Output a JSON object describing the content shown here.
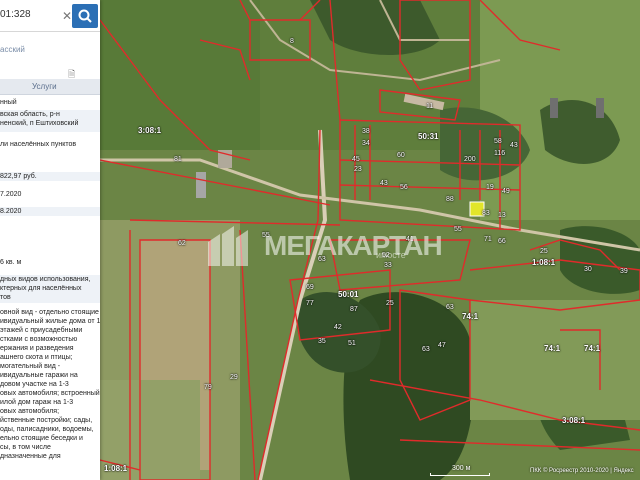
{
  "search": {
    "value": "01:328"
  },
  "subtitle": "асский",
  "tabs": {
    "services": "Услуги"
  },
  "info_rows": [
    "нный",
    "вская область, р-н",
    "ненский, п Ештиховский",
    "ли населённых пунктов",
    "822,97 руб.",
    "7.2020",
    "8.2020",
    "6 кв. м",
    "дных видов использования,",
    "ктерных для населённых",
    "тов",
    "овной вид - отдельно стоящие",
    "ивидуальный жилые дома от 1",
    "этажей с приусадебными",
    "стками с возможностью",
    "ержания и разведения",
    "ашнего скота и птицы;",
    "могательный вид -",
    "ивидуальные гаражи на",
    "довом участке на 1-3",
    "овых автомобиля; встроенный",
    "илой дом гараж на 1-3",
    "овых автомобиля;",
    "йственные постройки; сады,",
    "оды, палисадники, водоемы,",
    "ельно стоящие беседки и",
    "сы, в том числе",
    "дназначенные для"
  ],
  "map": {
    "watermark": "МЕГАКАРТАН",
    "watermark_sub": "имосте",
    "scale_label": "300 м",
    "copyright": "ПКК © Росреестр 2010-2020 | Яндекс",
    "zones": [
      "3:08:1",
      "50:31",
      "1:08:1",
      "50:01",
      "74:1",
      "74:1",
      "74:1",
      "3:08:1",
      "1:08:1"
    ],
    "parcels": [
      "8",
      "11",
      "58",
      "116",
      "200",
      "43",
      "38",
      "34",
      "60",
      "45",
      "23",
      "43",
      "56",
      "81",
      "19",
      "49",
      "88",
      "83",
      "13",
      "62",
      "55",
      "71",
      "66",
      "25",
      "30",
      "39",
      "52",
      "63",
      "69",
      "77",
      "63",
      "87",
      "42",
      "51",
      "35",
      "79",
      "29",
      "55",
      "41",
      "33",
      "47",
      "63",
      "25"
    ]
  }
}
